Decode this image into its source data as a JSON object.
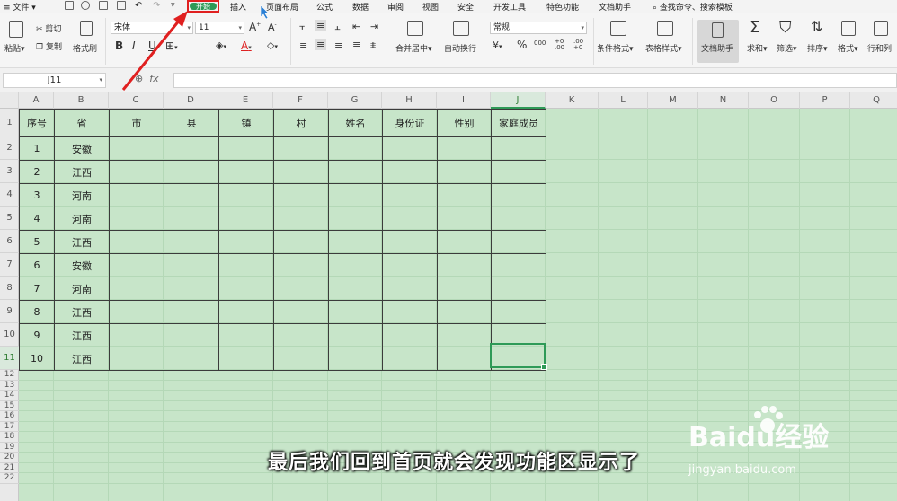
{
  "menu": {
    "file_label": "文件",
    "tabs": [
      "开始",
      "插入",
      "页面布局",
      "公式",
      "数据",
      "审阅",
      "视图",
      "安全",
      "开发工具",
      "特色功能",
      "文档助手"
    ],
    "active_tab": "开始",
    "search_label": "查找命令、搜索模板"
  },
  "ribbon": {
    "paste": "粘贴",
    "cut": "剪切",
    "copy": "复制",
    "format_painter": "格式刷",
    "font_name": "宋体",
    "font_size": "11",
    "bold": "B",
    "italic": "I",
    "underline": "U",
    "font_color_letter": "A",
    "merge_center": "合并居中",
    "wrap_text": "自动换行",
    "number_format": "常规",
    "currency_symbol": "¥",
    "percent_symbol": "%",
    "thousands_symbol": "000",
    "decimal_increase": "+0 .00",
    "decimal_decrease": ".00 +0",
    "conditional_format": "条件格式",
    "table_style": "表格样式",
    "doc_assistant": "文档助手",
    "sum": "求和",
    "filter": "筛选",
    "sort": "排序",
    "format": "格式",
    "row_col": "行和列"
  },
  "formula_bar": {
    "name_box": "J11",
    "fx": "fx",
    "value": ""
  },
  "columns": [
    "A",
    "B",
    "C",
    "D",
    "E",
    "F",
    "G",
    "H",
    "I",
    "J",
    "K",
    "L",
    "M",
    "N",
    "O",
    "P",
    "Q"
  ],
  "active_column": "J",
  "rows": [
    "1",
    "2",
    "3",
    "4",
    "5",
    "6",
    "7",
    "8",
    "9",
    "10",
    "11",
    "12",
    "13",
    "14",
    "15",
    "16",
    "17",
    "18",
    "19",
    "20",
    "21",
    "22"
  ],
  "active_row": "11",
  "table": {
    "headers": [
      "序号",
      "省",
      "市",
      "县",
      "镇",
      "村",
      "姓名",
      "身份证",
      "性别",
      "家庭成员"
    ],
    "rows": [
      [
        "1",
        "安徽",
        "",
        "",
        "",
        "",
        "",
        "",
        "",
        ""
      ],
      [
        "2",
        "江西",
        "",
        "",
        "",
        "",
        "",
        "",
        "",
        ""
      ],
      [
        "3",
        "河南",
        "",
        "",
        "",
        "",
        "",
        "",
        "",
        ""
      ],
      [
        "4",
        "河南",
        "",
        "",
        "",
        "",
        "",
        "",
        "",
        ""
      ],
      [
        "5",
        "江西",
        "",
        "",
        "",
        "",
        "",
        "",
        "",
        ""
      ],
      [
        "6",
        "安徽",
        "",
        "",
        "",
        "",
        "",
        "",
        "",
        ""
      ],
      [
        "7",
        "河南",
        "",
        "",
        "",
        "",
        "",
        "",
        "",
        ""
      ],
      [
        "8",
        "江西",
        "",
        "",
        "",
        "",
        "",
        "",
        "",
        ""
      ],
      [
        "9",
        "江西",
        "",
        "",
        "",
        "",
        "",
        "",
        "",
        ""
      ],
      [
        "10",
        "江西",
        "",
        "",
        "",
        "",
        "",
        "",
        "",
        ""
      ]
    ]
  },
  "subtitle": "最后我们回到首页就会发现功能区显示了",
  "watermark": {
    "brand": "Baidu经验",
    "url": "jingyan.baidu.com"
  },
  "colors": {
    "sheet_background": "#c7e5c9",
    "active_tab": "#2e9a57",
    "highlight_box": "#e02020",
    "selection": "#2e9a57"
  }
}
